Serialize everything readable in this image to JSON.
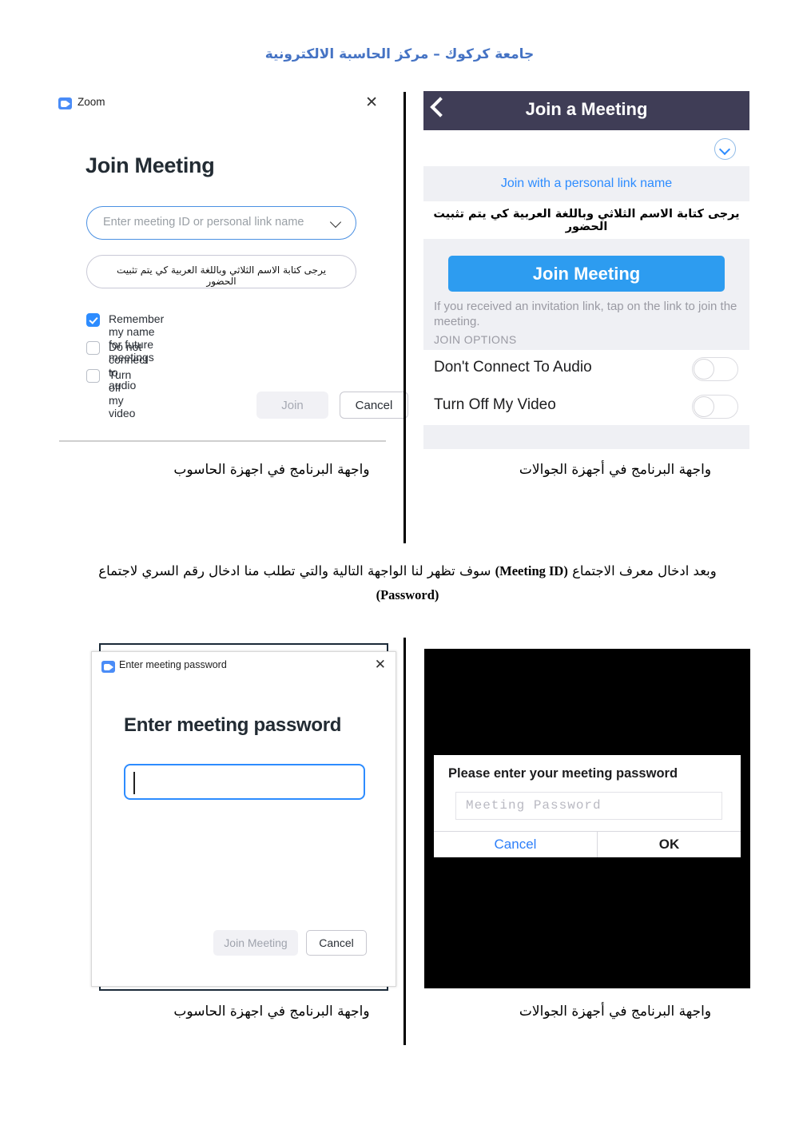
{
  "document": {
    "heading": "جامعة كركوك – مركز الحاسبة الالكترونية",
    "paragraph_prefix": "وبعد ادخال معرف الاجتماع ",
    "paragraph_bold1": "(Meeting ID)",
    "paragraph_mid": " سوف تظهر لنا الواجهة التالية والتي تطلب منا ادخال رقم السري لاجتماع ",
    "paragraph_bold2": "(Password)"
  },
  "captions": {
    "desktop": "واجهة البرنامج في اجهزة الحاسوب",
    "mobile": "واجهة البرنامج في أجهزة الجوالات"
  },
  "desktop_join": {
    "app_title": "Zoom",
    "close_glyph": "✕",
    "heading": "Join Meeting",
    "meeting_id_placeholder": "Enter meeting ID or personal link name",
    "name_value": "يرجى كتابة الاسم الثلاثي وباللغة العربية كي يتم تثبيت الحضور",
    "options": [
      {
        "label": "Remember my name for future meetings",
        "checked": true
      },
      {
        "label": "Do not connect to audio",
        "checked": false
      },
      {
        "label": "Turn off my video",
        "checked": false
      }
    ],
    "join_label": "Join",
    "cancel_label": "Cancel"
  },
  "mobile_join": {
    "nav_title": "Join a Meeting",
    "personal_link_label": "Join with a personal link name",
    "arabic_note": "يرجى كتابة الاسم الثلاثي وباللغة العربية كي يتم تثبيت الحضور",
    "join_button": "Join Meeting",
    "hint": "If you received an invitation link, tap on the link to join the meeting.",
    "section_header": "JOIN OPTIONS",
    "options": [
      {
        "label": "Don't Connect To Audio",
        "on": false
      },
      {
        "label": "Turn Off My Video",
        "on": false
      }
    ]
  },
  "desktop_password": {
    "app_title": "Enter meeting password",
    "close_glyph": "✕",
    "heading": "Enter meeting password",
    "input_value": "",
    "join_label": "Join Meeting",
    "cancel_label": "Cancel"
  },
  "mobile_password": {
    "title": "Please enter your meeting password",
    "placeholder": "Meeting Password",
    "cancel_label": "Cancel",
    "ok_label": "OK"
  },
  "colors": {
    "heading_blue": "#4573c4",
    "zoom_blue": "#2d8cff",
    "mobile_join_blue": "#2d9cf0",
    "navbar": "#3f3d56",
    "panel_grey": "#eff0f4"
  }
}
